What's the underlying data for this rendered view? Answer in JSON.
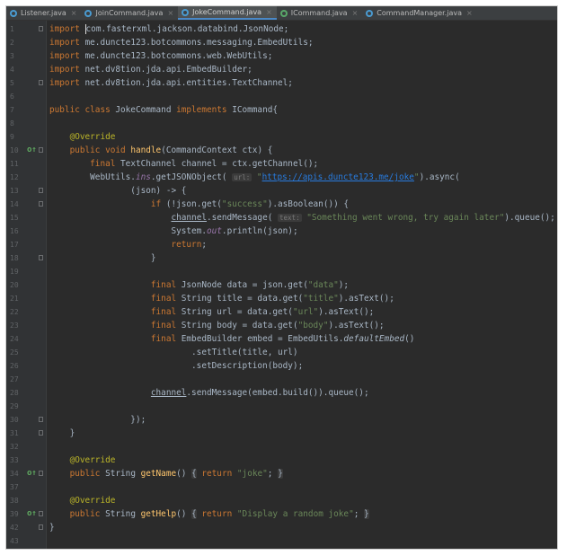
{
  "tabs": [
    {
      "label": "Listener.java",
      "icon": "class-icon",
      "active": false
    },
    {
      "label": "JoinCommand.java",
      "icon": "class-icon",
      "active": false
    },
    {
      "label": "JokeCommand.java",
      "icon": "class-icon",
      "active": true
    },
    {
      "label": "ICommand.java",
      "icon": "interface-icon",
      "active": false
    },
    {
      "label": "CommandManager.java",
      "icon": "class-icon",
      "active": false
    }
  ],
  "close_glyph": "×",
  "gutter_icons": {
    "override": "o↑",
    "fold": "fold-marker-icon"
  },
  "colors": {
    "background": "#2b2b2b",
    "keyword": "#cc7832",
    "annotation": "#bbb529",
    "method": "#ffc66d",
    "string": "#6a8759",
    "field": "#9876aa",
    "link": "#287bde"
  },
  "code": {
    "lines": [
      {
        "n": "1",
        "fold": true,
        "tokens": [
          {
            "c": "kw",
            "t": "import"
          },
          {
            "c": "",
            "t": " "
          },
          {
            "c": "caret",
            "t": ""
          },
          {
            "c": "",
            "t": "com.fasterxml.jackson.databind.JsonNode;"
          }
        ]
      },
      {
        "n": "2",
        "tokens": [
          {
            "c": "kw",
            "t": "import"
          },
          {
            "c": "",
            "t": " me.duncte123.botcommons.messaging.EmbedUtils;"
          }
        ]
      },
      {
        "n": "3",
        "tokens": [
          {
            "c": "kw",
            "t": "import"
          },
          {
            "c": "",
            "t": " me.duncte123.botcommons.web.WebUtils;"
          }
        ]
      },
      {
        "n": "4",
        "tokens": [
          {
            "c": "kw",
            "t": "import"
          },
          {
            "c": "",
            "t": " net.dv8tion.jda.api.EmbedBuilder;"
          }
        ]
      },
      {
        "n": "5",
        "fold": true,
        "tokens": [
          {
            "c": "kw",
            "t": "import"
          },
          {
            "c": "",
            "t": " net.dv8tion.jda.api.entities.TextChannel;"
          }
        ]
      },
      {
        "n": "6",
        "tokens": []
      },
      {
        "n": "7",
        "tokens": [
          {
            "c": "kw",
            "t": "public class"
          },
          {
            "c": "",
            "t": " JokeCommand "
          },
          {
            "c": "kw",
            "t": "implements"
          },
          {
            "c": "",
            "t": " ICommand{"
          }
        ]
      },
      {
        "n": "8",
        "tokens": []
      },
      {
        "n": "9",
        "tokens": [
          {
            "c": "",
            "t": "    "
          },
          {
            "c": "ann",
            "t": "@Override"
          }
        ]
      },
      {
        "n": "10",
        "override": true,
        "fold": true,
        "tokens": [
          {
            "c": "",
            "t": "    "
          },
          {
            "c": "kw",
            "t": "public void"
          },
          {
            "c": "",
            "t": " "
          },
          {
            "c": "fn",
            "t": "handle"
          },
          {
            "c": "",
            "t": "(CommandContext ctx) {"
          }
        ]
      },
      {
        "n": "11",
        "tokens": [
          {
            "c": "",
            "t": "        "
          },
          {
            "c": "kw",
            "t": "final"
          },
          {
            "c": "",
            "t": " TextChannel channel = ctx.getChannel();"
          }
        ]
      },
      {
        "n": "12",
        "tokens": [
          {
            "c": "",
            "t": "        WebUtils."
          },
          {
            "c": "fld",
            "t": "ins"
          },
          {
            "c": "",
            "t": ".getJSONObject( "
          },
          {
            "c": "hint",
            "t": "url:"
          },
          {
            "c": "",
            "t": " "
          },
          {
            "c": "str",
            "t": "\""
          },
          {
            "c": "url",
            "t": "https://apis.duncte123.me/joke"
          },
          {
            "c": "str",
            "t": "\""
          },
          {
            "c": "",
            "t": ").async("
          }
        ]
      },
      {
        "n": "13",
        "fold": true,
        "tokens": [
          {
            "c": "",
            "t": "                (json) -> {"
          }
        ]
      },
      {
        "n": "14",
        "fold": true,
        "tokens": [
          {
            "c": "",
            "t": "                    "
          },
          {
            "c": "kw",
            "t": "if"
          },
          {
            "c": "",
            "t": " (!json.get("
          },
          {
            "c": "str",
            "t": "\"success\""
          },
          {
            "c": "",
            "t": ").asBoolean()) {"
          }
        ]
      },
      {
        "n": "15",
        "tokens": [
          {
            "c": "",
            "t": "                        "
          },
          {
            "c": "ul",
            "t": "channel"
          },
          {
            "c": "",
            "t": ".sendMessage( "
          },
          {
            "c": "hint",
            "t": "text:"
          },
          {
            "c": "",
            "t": " "
          },
          {
            "c": "str",
            "t": "\"Something went wrong, try again later\""
          },
          {
            "c": "",
            "t": ").queue();"
          }
        ]
      },
      {
        "n": "16",
        "tokens": [
          {
            "c": "",
            "t": "                        System."
          },
          {
            "c": "fld",
            "t": "out"
          },
          {
            "c": "",
            "t": ".println(json);"
          }
        ]
      },
      {
        "n": "17",
        "tokens": [
          {
            "c": "",
            "t": "                        "
          },
          {
            "c": "kw",
            "t": "return"
          },
          {
            "c": "",
            "t": ";"
          }
        ]
      },
      {
        "n": "18",
        "fold": true,
        "tokens": [
          {
            "c": "",
            "t": "                    }"
          }
        ]
      },
      {
        "n": "19",
        "tokens": []
      },
      {
        "n": "20",
        "tokens": [
          {
            "c": "",
            "t": "                    "
          },
          {
            "c": "kw",
            "t": "final"
          },
          {
            "c": "",
            "t": " JsonNode data = json.get("
          },
          {
            "c": "str",
            "t": "\"data\""
          },
          {
            "c": "",
            "t": ");"
          }
        ]
      },
      {
        "n": "21",
        "tokens": [
          {
            "c": "",
            "t": "                    "
          },
          {
            "c": "kw",
            "t": "final"
          },
          {
            "c": "",
            "t": " String title = data.get("
          },
          {
            "c": "str",
            "t": "\"title\""
          },
          {
            "c": "",
            "t": ").asText();"
          }
        ]
      },
      {
        "n": "22",
        "tokens": [
          {
            "c": "",
            "t": "                    "
          },
          {
            "c": "kw",
            "t": "final"
          },
          {
            "c": "",
            "t": " String url = data.get("
          },
          {
            "c": "str",
            "t": "\"url\""
          },
          {
            "c": "",
            "t": ").asText();"
          }
        ]
      },
      {
        "n": "23",
        "tokens": [
          {
            "c": "",
            "t": "                    "
          },
          {
            "c": "kw",
            "t": "final"
          },
          {
            "c": "",
            "t": " String body = data.get("
          },
          {
            "c": "str",
            "t": "\"body\""
          },
          {
            "c": "",
            "t": ").asText();"
          }
        ]
      },
      {
        "n": "24",
        "tokens": [
          {
            "c": "",
            "t": "                    "
          },
          {
            "c": "kw",
            "t": "final"
          },
          {
            "c": "",
            "t": " EmbedBuilder embed = EmbedUtils."
          },
          {
            "c": "it",
            "t": "defaultEmbed"
          },
          {
            "c": "",
            "t": "()"
          }
        ]
      },
      {
        "n": "25",
        "tokens": [
          {
            "c": "",
            "t": "                            .setTitle(title, url)"
          }
        ]
      },
      {
        "n": "26",
        "tokens": [
          {
            "c": "",
            "t": "                            .setDescription(body);"
          }
        ]
      },
      {
        "n": "27",
        "tokens": []
      },
      {
        "n": "28",
        "tokens": [
          {
            "c": "",
            "t": "                    "
          },
          {
            "c": "ul",
            "t": "channel"
          },
          {
            "c": "",
            "t": ".sendMessage(embed.build()).queue();"
          }
        ]
      },
      {
        "n": "29",
        "tokens": []
      },
      {
        "n": "30",
        "fold": true,
        "tokens": [
          {
            "c": "",
            "t": "                });"
          }
        ]
      },
      {
        "n": "31",
        "fold": true,
        "tokens": [
          {
            "c": "",
            "t": "    }"
          }
        ]
      },
      {
        "n": "32",
        "tokens": []
      },
      {
        "n": "33",
        "tokens": [
          {
            "c": "",
            "t": "    "
          },
          {
            "c": "ann",
            "t": "@Override"
          }
        ]
      },
      {
        "n": "34",
        "override": true,
        "fold": true,
        "tokens": [
          {
            "c": "",
            "t": "    "
          },
          {
            "c": "kw",
            "t": "public"
          },
          {
            "c": "",
            "t": " String "
          },
          {
            "c": "fn",
            "t": "getName"
          },
          {
            "c": "",
            "t": "() "
          },
          {
            "c": "foldbox",
            "t": "{"
          },
          {
            "c": "",
            "t": " "
          },
          {
            "c": "kw",
            "t": "return"
          },
          {
            "c": "",
            "t": " "
          },
          {
            "c": "str",
            "t": "\"joke\""
          },
          {
            "c": "",
            "t": "; "
          },
          {
            "c": "foldbox",
            "t": "}"
          }
        ]
      },
      {
        "n": "37",
        "tokens": []
      },
      {
        "n": "38",
        "tokens": [
          {
            "c": "",
            "t": "    "
          },
          {
            "c": "ann",
            "t": "@Override"
          }
        ]
      },
      {
        "n": "39",
        "override": true,
        "fold": true,
        "tokens": [
          {
            "c": "",
            "t": "    "
          },
          {
            "c": "kw",
            "t": "public"
          },
          {
            "c": "",
            "t": " String "
          },
          {
            "c": "fn",
            "t": "getHelp"
          },
          {
            "c": "",
            "t": "() "
          },
          {
            "c": "foldbox",
            "t": "{"
          },
          {
            "c": "",
            "t": " "
          },
          {
            "c": "kw",
            "t": "return"
          },
          {
            "c": "",
            "t": " "
          },
          {
            "c": "str",
            "t": "\"Display a random joke\""
          },
          {
            "c": "",
            "t": "; "
          },
          {
            "c": "foldbox",
            "t": "}"
          }
        ]
      },
      {
        "n": "42",
        "fold": true,
        "tokens": [
          {
            "c": "",
            "t": "}"
          }
        ]
      },
      {
        "n": "43",
        "tokens": []
      }
    ]
  }
}
